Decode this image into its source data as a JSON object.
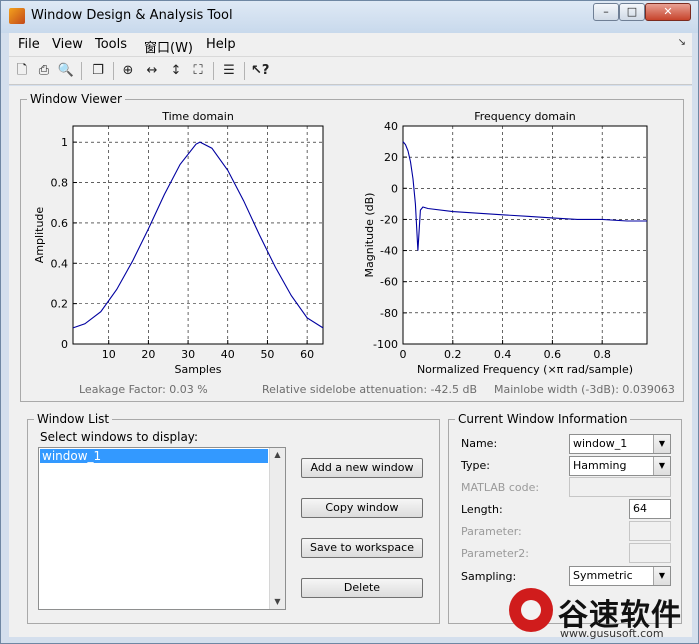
{
  "window": {
    "title": "Window Design & Analysis Tool",
    "controls": {
      "minimize": "–",
      "maximize": "□",
      "close": "✕"
    }
  },
  "menu": [
    "File",
    "View",
    "Tools",
    "窗口(W)",
    "Help"
  ],
  "menu_arrow": "↘",
  "toolbar_icons": [
    "new-icon",
    "print-icon",
    "print-preview-icon",
    "copy-to-figure-icon",
    "zoom-in-icon",
    "zoom-x-icon",
    "zoom-y-icon",
    "full-view-icon",
    "legend-icon",
    "whats-this-icon"
  ],
  "viewer": {
    "title": "Window Viewer",
    "leakage": "Leakage Factor: 0.03 %",
    "sidelobe": "Relative sidelobe attenuation: -42.5 dB",
    "mainlobe": "Mainlobe width (-3dB): 0.039063"
  },
  "chart_data": [
    {
      "type": "line",
      "title": "Time domain",
      "xlabel": "Samples",
      "ylabel": "Amplitude",
      "xlim": [
        1,
        64
      ],
      "ylim": [
        0,
        1.08
      ],
      "xticks": [
        10,
        20,
        30,
        40,
        50,
        60
      ],
      "yticks": [
        0,
        0.2,
        0.4,
        0.6,
        0.8,
        1
      ],
      "ytick_labels": [
        "0",
        "0.2",
        "0.4",
        "0.6",
        "0.8",
        "1"
      ],
      "grid": true,
      "series": [
        {
          "color": "#0000a0",
          "x": [
            1,
            4,
            8,
            12,
            16,
            20,
            24,
            28,
            32,
            33,
            36,
            40,
            44,
            48,
            52,
            56,
            60,
            64
          ],
          "y": [
            0.08,
            0.1,
            0.16,
            0.27,
            0.41,
            0.57,
            0.74,
            0.89,
            0.99,
            1.0,
            0.97,
            0.86,
            0.71,
            0.54,
            0.38,
            0.24,
            0.13,
            0.08
          ]
        }
      ]
    },
    {
      "type": "line",
      "title": "Frequency domain",
      "xlabel": "Normalized Frequency  (×π rad/sample)",
      "ylabel": "Magnitude (dB)",
      "xlim": [
        0,
        0.98
      ],
      "ylim": [
        -100,
        40
      ],
      "xticks": [
        0,
        0.2,
        0.4,
        0.6,
        0.8
      ],
      "xtick_labels": [
        "0",
        "0.2",
        "0.4",
        "0.6",
        "0.8"
      ],
      "yticks": [
        -100,
        -80,
        -60,
        -40,
        -20,
        0,
        20,
        40
      ],
      "grid": true,
      "series": [
        {
          "color": "#0000a0",
          "x": [
            0,
            0.01,
            0.02,
            0.03,
            0.04,
            0.05,
            0.06,
            0.07,
            0.08,
            0.1,
            0.2,
            0.3,
            0.4,
            0.5,
            0.6,
            0.7,
            0.8,
            0.9,
            0.98
          ],
          "y": [
            30,
            28,
            24,
            17,
            6,
            -10,
            -40,
            -14,
            -12,
            -13,
            -15,
            -16,
            -17,
            -18,
            -19,
            -20,
            -20,
            -21,
            -21
          ]
        }
      ]
    }
  ],
  "window_list": {
    "title": "Window List",
    "select_label": "Select windows to display:",
    "items": [
      "window_1"
    ],
    "buttons": {
      "add": "Add a new window",
      "copy": "Copy window",
      "save": "Save to workspace",
      "delete": "Delete"
    }
  },
  "current_window": {
    "title": "Current Window Information",
    "name_label": "Name:",
    "name_value": "window_1",
    "type_label": "Type:",
    "type_value": "Hamming",
    "matlab_label": "MATLAB code:",
    "length_label": "Length:",
    "length_value": "64",
    "param_label": "Parameter:",
    "param2_label": "Parameter2:",
    "sampling_label": "Sampling:",
    "sampling_value": "Symmetric"
  },
  "watermark": {
    "cn_text": "谷速软件",
    "url": "www.gususoft.com"
  }
}
